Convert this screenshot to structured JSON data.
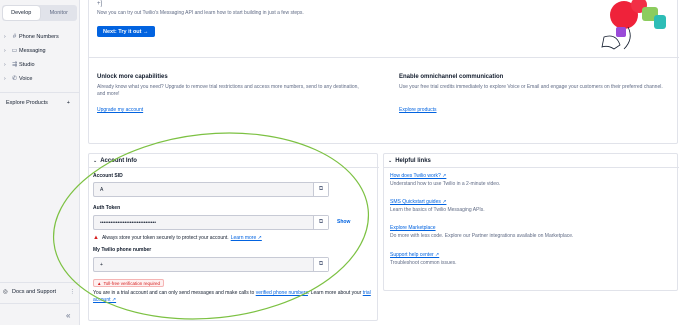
{
  "sidebar": {
    "tabs": [
      {
        "label": "Develop"
      },
      {
        "label": "Monitor"
      }
    ],
    "items": [
      {
        "label": "Phone Numbers",
        "icon": "hash-icon"
      },
      {
        "label": "Messaging",
        "icon": "chat-icon"
      },
      {
        "label": "Studio",
        "icon": "flow-icon"
      },
      {
        "label": "Voice",
        "icon": "phone-icon"
      }
    ],
    "explore_label": "Explore Products",
    "explore_plus": "+",
    "docs_label": "Docs and Support",
    "docs_more": "⋮",
    "collapse": "«"
  },
  "hero": {
    "text": "Now you can try out Twilio's Messaging API and learn how to start building in just a few steps.",
    "button": "Next: Try it out →"
  },
  "capabilities": {
    "title": "Unlock more capabilities",
    "body": "Already know what you need? Upgrade to remove trial restrictions and access more numbers, send to any destination, and more!",
    "link": "Upgrade my account"
  },
  "omnichannel": {
    "title": "Enable omnichannel communication",
    "body": "Use your free trial credits immediately to explore Voice or Email and engage your customers on their preferred channel.",
    "link": "Explore products"
  },
  "account": {
    "title": "Account Info",
    "sid_label": "Account SID",
    "sid_value": "A",
    "token_label": "Auth Token",
    "token_value": "••••••••••••••••••••••••••••••••",
    "show": "Show",
    "token_warning": "Always store your token securely to protect your account.",
    "learn_more": "Learn more ↗",
    "phone_label": "My Twilio phone number",
    "phone_value": "+",
    "verification_badge": "Toll-free verification required",
    "trial_note_1": "You are in a trial account and can only send messages and make calls to",
    "trial_link": "verified phone numbers",
    "trial_note_2": ". Learn more about your",
    "trial_link_2": "trial account ↗"
  },
  "helpful": {
    "title": "Helpful links",
    "links": [
      {
        "title": "How does Twilio work? ↗",
        "desc": "Understand how to use Twilio in a 2-minute video."
      },
      {
        "title": "SMS Quickstart guides ↗",
        "desc": "Learn the basics of Twilio Messaging APIs."
      },
      {
        "title": "Explore Marketplace",
        "desc": "Do more with less code. Explore our Partner integrations available on Marketplace."
      },
      {
        "title": "Support help center ↗",
        "desc": "Troubleshoot common issues."
      }
    ]
  },
  "colors": {
    "accent": "#0263e0",
    "annotation": "#7cc142",
    "error": "#d61f1f"
  }
}
